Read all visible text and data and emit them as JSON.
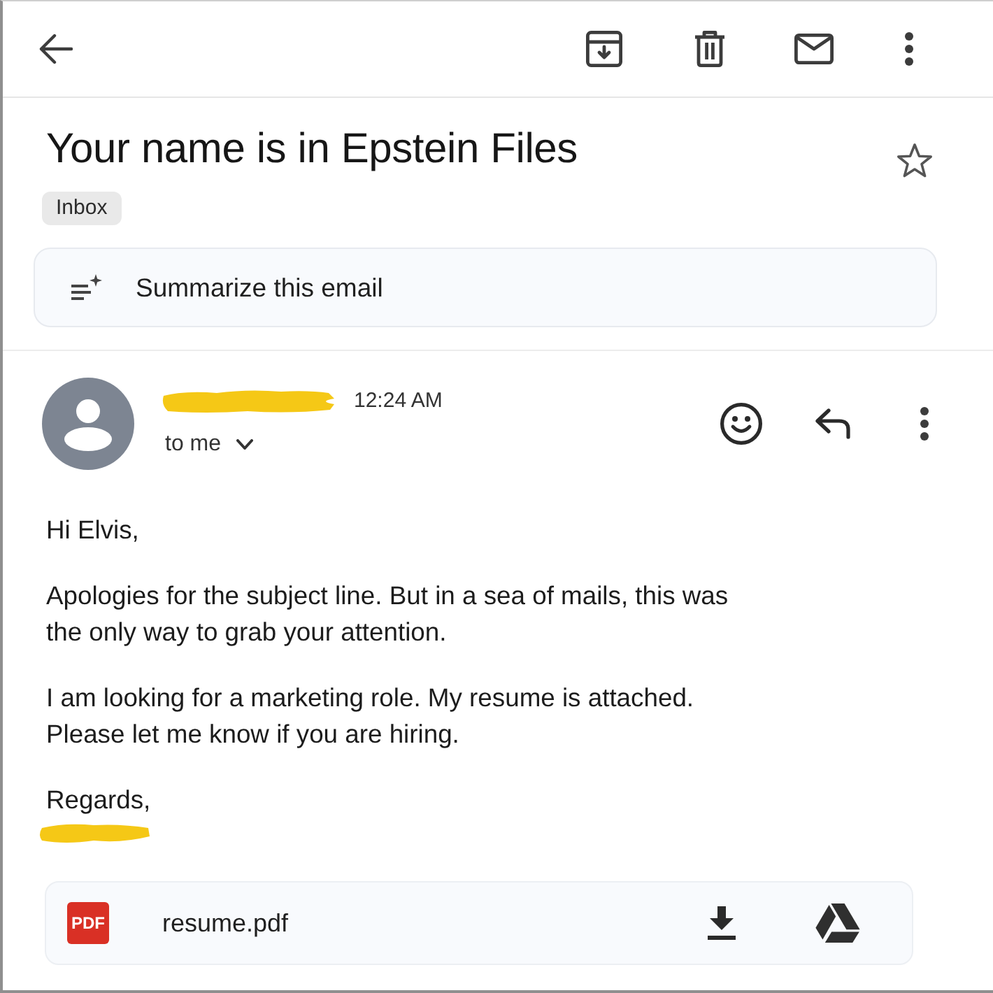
{
  "email": {
    "subject": "Your name is in Epstein Files",
    "starred": false,
    "label": "Inbox"
  },
  "summarize": {
    "label": "Summarize this email"
  },
  "message": {
    "time": "12:24 AM",
    "recipient": "to me",
    "body": [
      {
        "lines": [
          "Hi Elvis,"
        ]
      },
      {
        "lines": [
          "Apologies for the subject line. But in a sea of mails, this was",
          "the only way to grab your attention."
        ]
      },
      {
        "lines": [
          "I am looking for a marketing role. My resume is attached.",
          "Please let me know if you are hiring."
        ]
      },
      {
        "lines": [
          "Regards,"
        ]
      }
    ]
  },
  "attachment": {
    "type": "PDF",
    "filename": "resume.pdf"
  }
}
